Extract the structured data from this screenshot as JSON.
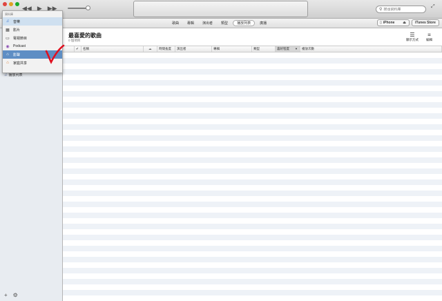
{
  "window": {
    "controls": [
      "close",
      "minimize",
      "zoom"
    ]
  },
  "transport": {
    "prev_icon": "rewind-icon",
    "play_icon": "play-icon",
    "next_icon": "fast-forward-icon",
    "volume": 0.9
  },
  "search": {
    "placeholder": "搜尋資料庫"
  },
  "nav": {
    "tabs": [
      {
        "label": "歌曲",
        "active": false
      },
      {
        "label": "專輯",
        "active": false
      },
      {
        "label": "演出者",
        "active": false
      },
      {
        "label": "類型",
        "active": false
      },
      {
        "label": "播放列表",
        "active": true
      },
      {
        "label": "廣播",
        "active": false
      }
    ],
    "device_label": "iPhone",
    "store_label": "iTunes Store"
  },
  "library_menu": {
    "header": "資料庫",
    "items": [
      {
        "label": "音樂",
        "icon": "music-note-icon",
        "state": "selected"
      },
      {
        "label": "影片",
        "icon": "film-icon",
        "state": ""
      },
      {
        "label": "電視節目",
        "icon": "tv-icon",
        "state": ""
      },
      {
        "label": "Podcast",
        "icon": "podcast-icon",
        "state": ""
      },
      {
        "label": "影聲",
        "icon": "itunes-u-icon",
        "state": "highlight"
      },
      {
        "label": "家庭共享",
        "icon": "home-sharing-icon",
        "state": ""
      }
    ]
  },
  "sidebar": {
    "playlists_label": "播放列表"
  },
  "playlist": {
    "title": "最喜愛的歌曲",
    "count": "0 個項目",
    "tools": [
      {
        "label": "顯示方式",
        "icon": "view-options-icon"
      },
      {
        "label": "編輯",
        "icon": "edit-playlist-icon"
      }
    ]
  },
  "columns": [
    {
      "label": ""
    },
    {
      "label": "✔"
    },
    {
      "label": "名稱"
    },
    {
      "label": ""
    },
    {
      "label": "時間長度"
    },
    {
      "label": "演出者"
    },
    {
      "label": "專輯"
    },
    {
      "label": "類型"
    },
    {
      "label": "喜好程度",
      "sorted": true
    },
    {
      "label": "播放次數"
    }
  ]
}
